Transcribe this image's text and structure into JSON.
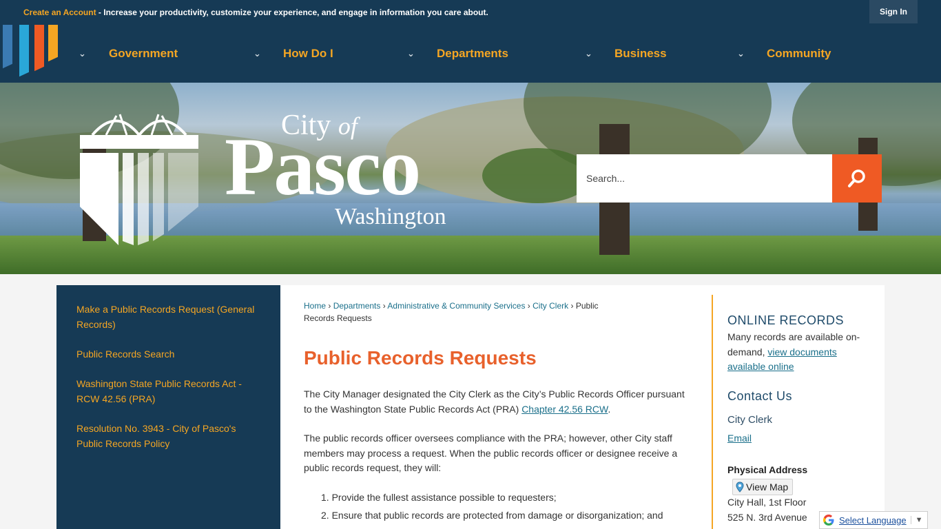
{
  "topbar": {
    "create_account": "Create an Account",
    "message": " - Increase your productivity, customize your experience, and engage in information you care about.",
    "sign_in": "Sign In"
  },
  "nav": [
    {
      "label": "Government"
    },
    {
      "label": "How Do I"
    },
    {
      "label": "Departments"
    },
    {
      "label": "Business"
    },
    {
      "label": "Community"
    }
  ],
  "brand": {
    "city_of_1": "City",
    "city_of_2": "of",
    "name": "Pasco",
    "state": "Washington"
  },
  "search": {
    "placeholder": "Search..."
  },
  "sidebar": {
    "links": [
      "Make a Public Records Request (General Records)",
      "Public Records Search",
      "Washington State Public Records Act - RCW 42.56 (PRA)",
      "Resolution No. 3943 - City of Pasco's Public Records Policy"
    ]
  },
  "breadcrumb": {
    "home": "Home",
    "departments": "Departments",
    "admin": "Administrative & Community Services",
    "clerk": "City Clerk",
    "current": "Public Records Requests",
    "sep": " › "
  },
  "main": {
    "title": "Public Records Requests",
    "p1_text": "The City Manager designated the City Clerk as the City’s Public Records Officer pursuant to the Washington State Public Records Act (PRA) ",
    "p1_link": "Chapter 42.56 RCW",
    "p1_end": ".",
    "p2": "The public records officer oversees compliance with the PRA; however, other City staff members may process a request. When the public records officer or designee receive a public records request, they will:",
    "list": [
      "1. Provide the fullest assistance possible to requesters;",
      "2. Ensure that public records are protected from damage or disorganization; and"
    ]
  },
  "right": {
    "online_title": "ONLINE RECORDS",
    "online_text": "Many records are available on-demand, ",
    "online_link": "view documents available online",
    "contact_title": "Contact Us",
    "contact_name": "City Clerk",
    "email": "Email",
    "address_label": "Physical Address",
    "view_map": "View Map",
    "addr1": "City Hall, 1st Floor",
    "addr2": "525 N. 3rd Avenue"
  },
  "translate": {
    "label": "Select Language",
    "arrow": "▼"
  },
  "colors": {
    "navy": "#163a55",
    "orange": "#f5a623",
    "accent": "#ef5a24",
    "title": "#e8612c"
  }
}
